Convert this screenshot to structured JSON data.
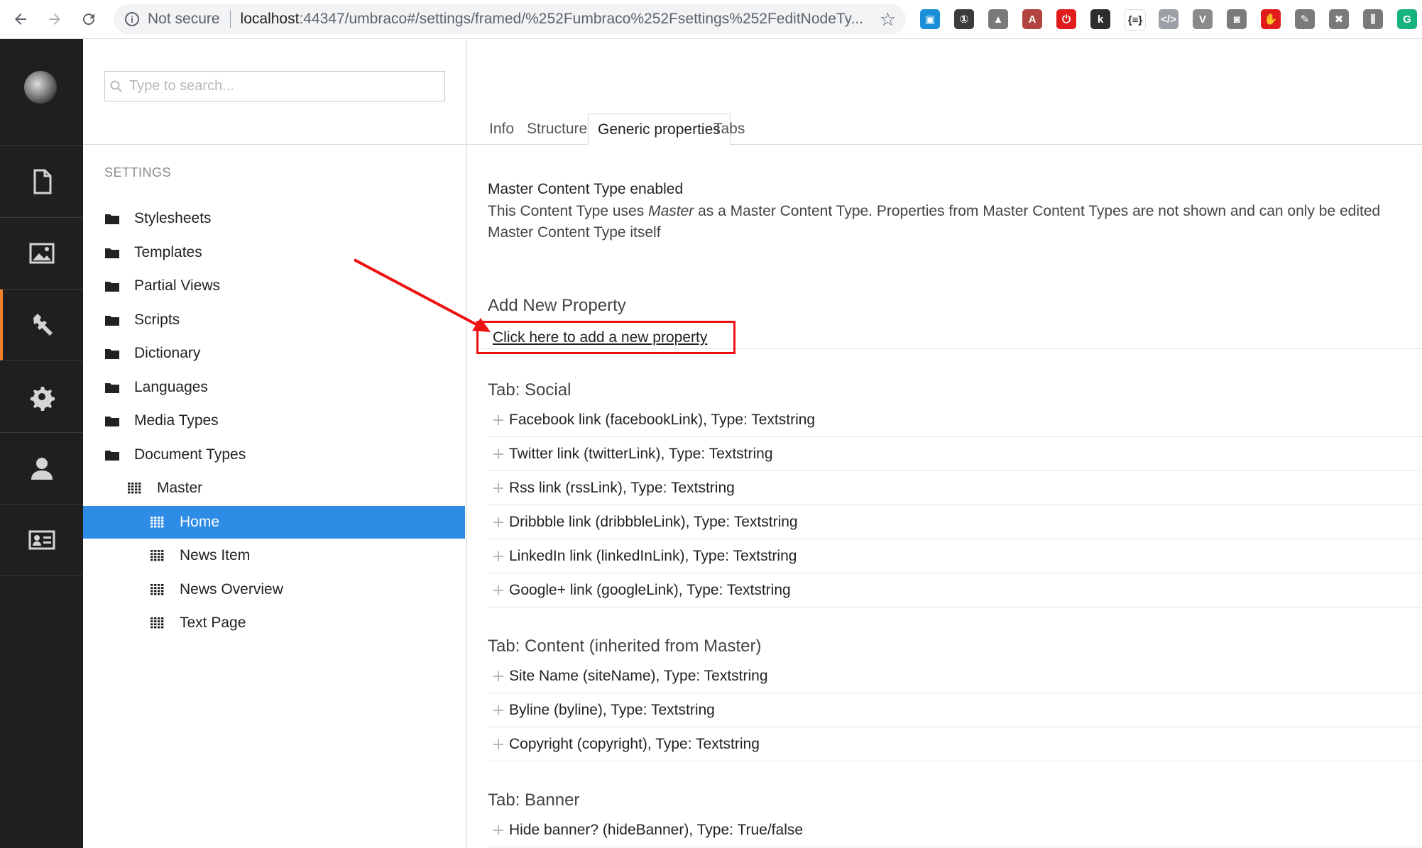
{
  "browser": {
    "security_text": "Not secure",
    "url_host": "localhost",
    "url_path": ":44347/umbraco#/settings/framed/%252Fumbraco%252Fsettings%252FeditNodeTy...",
    "extensions": [
      {
        "icon": "photo-extension-icon",
        "color": "#1a8fd8",
        "glyph": "▣"
      },
      {
        "icon": "password-manager-icon",
        "color": "#3b3b3b",
        "glyph": "①"
      },
      {
        "icon": "drive-icon",
        "color": "#7a7a7a",
        "glyph": "▲"
      },
      {
        "icon": "pdf-icon",
        "color": "#b1443e",
        "glyph": "A"
      },
      {
        "icon": "power-icon",
        "color": "#e01c1c",
        "glyph": "⏻"
      },
      {
        "icon": "k-icon",
        "color": "#2d2d2d",
        "glyph": "k"
      },
      {
        "icon": "json-icon",
        "color": "#ffffff",
        "glyph": "{≡}"
      },
      {
        "icon": "code-icon",
        "color": "#9aa0a6",
        "glyph": "</>"
      },
      {
        "icon": "vue-icon",
        "color": "#8a8a8a",
        "glyph": "V"
      },
      {
        "icon": "camera-icon",
        "color": "#7a7a7a",
        "glyph": "◙"
      },
      {
        "icon": "adblock-icon",
        "color": "#e01c1c",
        "glyph": "✋"
      },
      {
        "icon": "notes-icon",
        "color": "#7a7a7a",
        "glyph": "✎"
      },
      {
        "icon": "close-tab-icon",
        "color": "#7a7a7a",
        "glyph": "✖"
      },
      {
        "icon": "bars-icon",
        "color": "#7a7a7a",
        "glyph": "⫼"
      },
      {
        "icon": "grammarly-icon",
        "color": "#16b27f",
        "glyph": "G"
      }
    ]
  },
  "appbar": {
    "sections": [
      "content-icon",
      "media-icon",
      "settings-wrench-icon",
      "developer-gear-icon",
      "users-icon",
      "members-icon"
    ],
    "active_index": 2,
    "accent_color": "#f5822a"
  },
  "tree": {
    "search_placeholder": "Type to search...",
    "heading": "SETTINGS",
    "items": [
      {
        "label": "Stylesheets",
        "icon": "folder-icon",
        "depth": 0,
        "selected": false
      },
      {
        "label": "Templates",
        "icon": "folder-icon",
        "depth": 0,
        "selected": false
      },
      {
        "label": "Partial Views",
        "icon": "folder-icon",
        "depth": 0,
        "selected": false
      },
      {
        "label": "Scripts",
        "icon": "folder-icon",
        "depth": 0,
        "selected": false
      },
      {
        "label": "Dictionary",
        "icon": "folder-icon",
        "depth": 0,
        "selected": false
      },
      {
        "label": "Languages",
        "icon": "folder-icon",
        "depth": 0,
        "selected": false
      },
      {
        "label": "Media Types",
        "icon": "folder-icon",
        "depth": 0,
        "selected": false
      },
      {
        "label": "Document Types",
        "icon": "folder-icon",
        "depth": 0,
        "selected": false
      },
      {
        "label": "Master",
        "icon": "doctype-grid-icon",
        "depth": 1,
        "selected": false
      },
      {
        "label": "Home",
        "icon": "doctype-grid-icon",
        "depth": 2,
        "selected": true
      },
      {
        "label": "News Item",
        "icon": "doctype-grid-icon",
        "depth": 2,
        "selected": false
      },
      {
        "label": "News Overview",
        "icon": "doctype-grid-icon",
        "depth": 2,
        "selected": false
      },
      {
        "label": "Text Page",
        "icon": "doctype-grid-icon",
        "depth": 2,
        "selected": false
      }
    ],
    "selected_color": "#2e8be6"
  },
  "main": {
    "tabs": [
      "Info",
      "Structure",
      "Generic properties",
      "Tabs"
    ],
    "active_tab": 2,
    "notice": {
      "title": "Master Content Type enabled",
      "line1_pre": "This Content Type uses ",
      "line1_em": "Master",
      "line1_post": " as a Master Content Type. Properties from Master Content Types are not shown and can only be edited",
      "line2": "Master Content Type itself"
    },
    "add_property": {
      "heading": "Add New Property",
      "link": "Click here to add a new property",
      "highlight_color": "#ee1111"
    },
    "groups": [
      {
        "title": "Tab: Social",
        "properties": [
          "Facebook link (facebookLink), Type: Textstring",
          "Twitter link (twitterLink), Type: Textstring",
          "Rss link (rssLink), Type: Textstring",
          "Dribbble link (dribbbleLink), Type: Textstring",
          "LinkedIn link (linkedInLink), Type: Textstring",
          "Google+ link (googleLink), Type: Textstring"
        ]
      },
      {
        "title": "Tab: Content (inherited from Master)",
        "properties": [
          "Site Name (siteName), Type: Textstring",
          "Byline (byline), Type: Textstring",
          "Copyright (copyright), Type: Textstring"
        ]
      },
      {
        "title": "Tab: Banner",
        "properties": [
          "Hide banner? (hideBanner), Type: True/false"
        ]
      }
    ]
  }
}
